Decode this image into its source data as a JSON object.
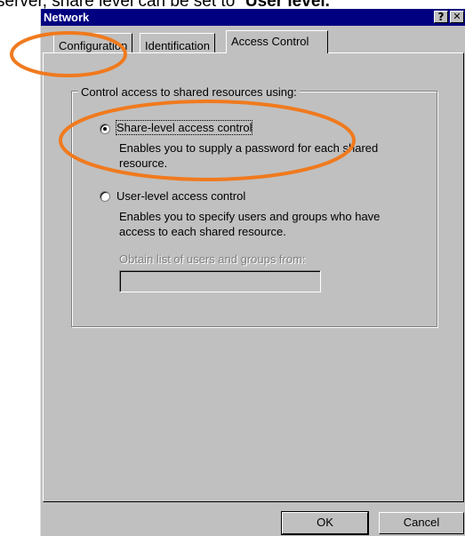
{
  "background_caption": {
    "prefix": "server, share level can be set to “",
    "bold": "User level."
  },
  "window": {
    "title": "Network",
    "help_button": "?",
    "close_button": "✕"
  },
  "tabs": [
    {
      "label": "Configuration"
    },
    {
      "label": "Identification"
    },
    {
      "label": "Access Control"
    }
  ],
  "group": {
    "label": "Control access to shared resources using:",
    "options": [
      {
        "label": "Share-level access control",
        "description_line1": "Enables you to supply a password for each shared",
        "description_line2": "resource.",
        "selected": true
      },
      {
        "label": "User-level access control",
        "description_line1": "Enables you to specify users and groups who have",
        "description_line2": "access to each shared resource.",
        "selected": false
      }
    ],
    "obtain_label": "Obtain list of users and groups from:",
    "obtain_value": ""
  },
  "buttons": {
    "ok": "OK",
    "cancel": "Cancel"
  },
  "colors": {
    "annotation": "#f07a1e",
    "titlebar": "#000080",
    "face": "#c0c0c0"
  }
}
